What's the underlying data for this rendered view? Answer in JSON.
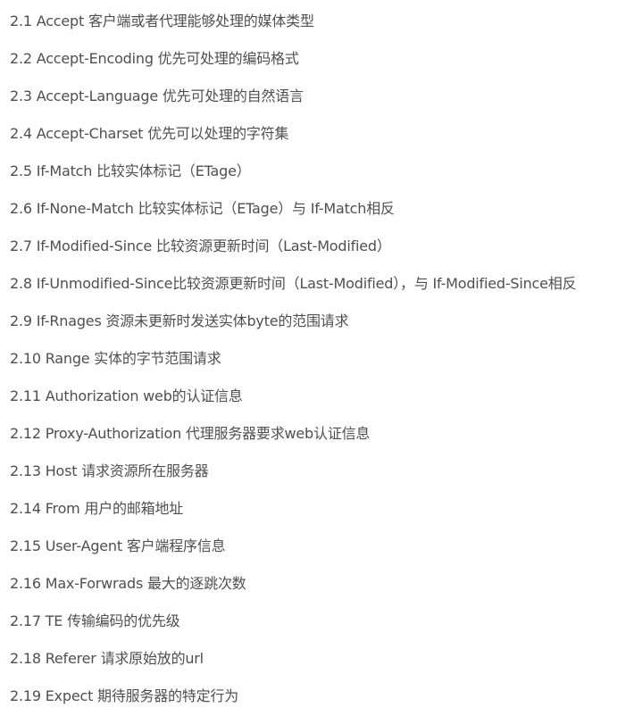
{
  "items": [
    "2.1 Accept 客户端或者代理能够处理的媒体类型",
    "2.2 Accept-Encoding 优先可处理的编码格式",
    "2.3 Accept-Language 优先可处理的自然语言",
    "2.4 Accept-Charset 优先可以处理的字符集",
    "2.5 If-Match 比较实体标记（ETage）",
    "2.6 If-None-Match 比较实体标记（ETage）与 If-Match相反",
    "2.7 If-Modified-Since 比较资源更新时间（Last-Modified）",
    "2.8 If-Unmodified-Since比较资源更新时间（Last-Modified），与 If-Modified-Since相反",
    "2.9 If-Rnages 资源未更新时发送实体byte的范围请求",
    "2.10 Range 实体的字节范围请求",
    "2.11 Authorization web的认证信息",
    "2.12 Proxy-Authorization 代理服务器要求web认证信息",
    "2.13 Host 请求资源所在服务器",
    "2.14 From 用户的邮箱地址",
    "2.15 User-Agent 客户端程序信息",
    "2.16 Max-Forwrads 最大的逐跳次数",
    "2.17 TE 传输编码的优先级",
    "2.18 Referer 请求原始放的url",
    "2.19 Expect 期待服务器的特定行为"
  ]
}
